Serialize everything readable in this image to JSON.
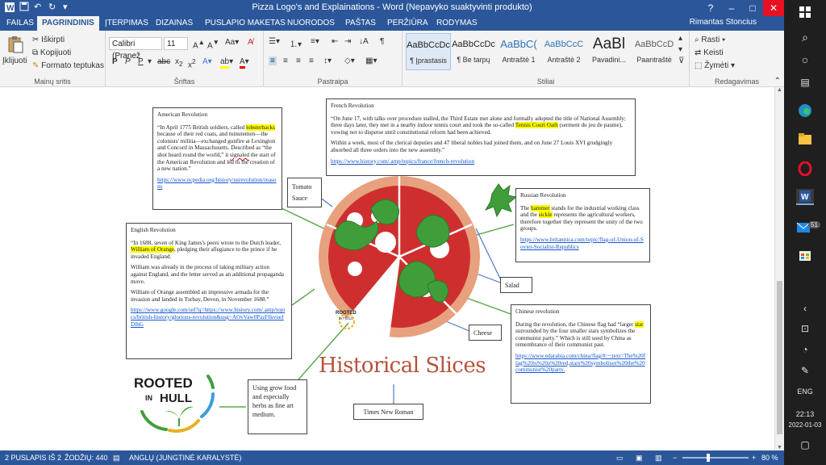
{
  "title_bar": {
    "title": "Pizza Logo's and Explainations  -  Word (Nepavyko suaktyvinti produkto)",
    "window_controls": [
      "?",
      "–",
      "□",
      "✕"
    ]
  },
  "menu": {
    "file": "FAILAS",
    "tabs": [
      "PAGRINDINIS",
      "ĮTERPIMAS",
      "DIZAINAS",
      "PUSLAPIO MAKETAS",
      "NUORODOS",
      "PAŠTAS",
      "PERŽIŪRA",
      "RODYMAS"
    ],
    "active_tab": "PAGRINDINIS",
    "user": "Rimantas Stoncius"
  },
  "ribbon": {
    "clipboard": {
      "paste": "Įklijuoti",
      "cut": "Iškirpti",
      "copy": "Kopijuoti",
      "format_painter": "Formato teptukas",
      "label": "Mainų sritis"
    },
    "font": {
      "name": "Calibri (Pranešimo tekstas)",
      "name_display": "Calibri (Pranež",
      "size": "11",
      "label": "Šriftas",
      "bold": "P",
      "italic": "P",
      "underline": "P"
    },
    "paragraph": {
      "label": "Pastraipa"
    },
    "styles": {
      "items": [
        {
          "sample": "AaBbCcDc",
          "name": "¶ Įprastasis"
        },
        {
          "sample": "AaBbCcDc",
          "name": "¶ Be tarpų"
        },
        {
          "sample": "AaBbC(",
          "name": "Antraštė 1"
        },
        {
          "sample": "AaBbCcC",
          "name": "Antraštė 2"
        },
        {
          "sample": "AaBl",
          "name": "Pavadini..."
        },
        {
          "sample": "AaBbCcD",
          "name": "Paantraštė"
        }
      ],
      "label": "Stiliai"
    },
    "editing": {
      "find": "Rasti",
      "replace": "Keisti",
      "select": "Žymėti",
      "label": "Redagavimas"
    }
  },
  "document": {
    "american": {
      "title": "American Revolution",
      "p1_a": "“In April 1775 British soldiers, called ",
      "p1_hl": "lobsterbacks",
      "p1_b": " because of their red coats, and minutemen—the colonists' militia—exchanged gunfire at Lexington and Concord in Massachusetts. Described as “the shot heard round the world,” it ",
      "p1_ul": "signaled",
      "p1_c": " the start of the American Revolution and led to the creation of a new nation.”",
      "link": "https://www.ncpedia.org/history/usrevolution/reasons"
    },
    "french": {
      "title": "French Revolution",
      "p1_a": "“On June 17, with talks over procedure stalled, the Third Estate met alone and formally adopted the title of National Assembly; three days later, they met in a nearby indoor tennis court and took the so-called ",
      "p1_hl": "Tennis Court Oath",
      "p1_b": " (serment du jeu de paume), vowing not to disperse until constitutional reform had been achieved.",
      "p2": "Within a week, most of the clerical deputies and 47 liberal nobles had joined them, and on June 27 Louis XVI grudgingly absorbed all three orders into the new assembly.”",
      "link": "https://www.history.com/.amp/topics/france/french-revolution"
    },
    "russian": {
      "title": "Russian Revolution",
      "p1_a": "The ",
      "p1_hl1": "hammer",
      "p1_b": " stands for the industrial working class and the ",
      "p1_hl2": "sickle",
      "p1_c": " represents the agricultural workers, therefore together they represent the unity of the two groups.",
      "link": "https://www.britannica.com/topic/flag-of-Union-of-Soviet-Socialist-Republics"
    },
    "english": {
      "title": "English Revolution",
      "p1_a": "“In 1688, seven of King James's peers wrote to the Dutch leader, ",
      "p1_hl": "William of Orange",
      "p1_b": ", pledging their allegiance to the prince if he invaded England.",
      "p2": "William was already in the process of taking military action against England, and the letter served as an additional propaganda move.",
      "p3": "William of Orange assembled an impressive armada for the invasion and landed in Torbay, Devon, in November 1688.”",
      "link": "https://www.google.com/url?q=https://www.history.com/.amp/topics/british-history/glorious-revolution&usg=AOvVaw0PazFIkvueJDlhG"
    },
    "chinese": {
      "title": "Chinese revolution",
      "p1_a": "During the revolution, the Chinese flag had “larger ",
      "p1_hl": "star",
      "p1_b": " surrounded by the four smaller stars symbolizes the communist party.” Which is still used by China as remembrance of their communist past.",
      "link": "https://www.edarabia.com/china/flag/#:~:text=The%20flag%20is%20a%20red,stars%20symbolises%20the%20communist%20party."
    },
    "labels": {
      "tomato_sauce": "Tomato Sauce",
      "salad": "Salad",
      "cheese": "Cheese",
      "times_new_roman": "Times New Roman",
      "grow_food": "Using grow food and especially herbs as fine art medium."
    },
    "heading": "Historical Slices",
    "logo": {
      "line1": "ROOTED",
      "line2": "IN HULL",
      "small_line1": "ROOTED",
      "small_line2": "in HULL"
    }
  },
  "status": {
    "page": "2 PUSLAPIS IŠ 2",
    "words": "ŽODŽIŲ: 440",
    "language": "ANGLŲ (JUNGTINĖ KARALYSTĖ)",
    "zoom": "80 %",
    "zoom_level": 80
  },
  "taskbar": {
    "mail_badge": "51",
    "language": "ENG",
    "time": "22:13",
    "date": "2022-01-03"
  },
  "colors": {
    "word_blue": "#2b579a",
    "crust": "#e7a17f",
    "sauce": "#cf2e2e",
    "basil": "#3f9e3a",
    "heading": "#b5523b",
    "highlight": "#ffff00"
  }
}
